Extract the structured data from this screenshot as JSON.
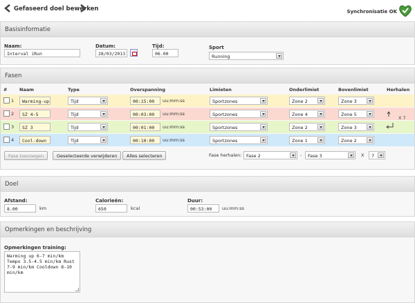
{
  "header": {
    "title": "Gefaseerd doel bewerken",
    "sync_status": "Synchronisatie OK"
  },
  "basis": {
    "heading": "Basisinformatie",
    "name_label": "Naam:",
    "name_value": "Interval iRun",
    "date_label": "Datum:",
    "date_value": "28/03/2013",
    "time_label": "Tijd:",
    "time_value": "06.00",
    "sport_label": "Sport",
    "sport_value": "Running"
  },
  "fasen": {
    "heading": "Fasen",
    "columns": [
      "#",
      "Naam",
      "Type",
      "Overspanning",
      "Limieten",
      "Onderlimiet",
      "Bovenlimiet",
      "Herhalen"
    ],
    "rows": [
      {
        "num": "1",
        "name": "Warming-up",
        "type": "Tijd",
        "span": "00:15:00",
        "unit": "uu:mm:ss",
        "limit": "Sportzones",
        "lower": "Zone 2",
        "upper": "Zone 3",
        "color": "#fdf3c6"
      },
      {
        "num": "2",
        "name": "SZ 4-5",
        "type": "Tijd",
        "span": "00:03:00",
        "unit": "uu:mm:ss",
        "limit": "Sportzones",
        "lower": "Zone 4",
        "upper": "Zone 5",
        "color": "#fbd9d1"
      },
      {
        "num": "3",
        "name": "SZ 3",
        "type": "Tijd",
        "span": "00:01:00",
        "unit": "uu:mm:ss",
        "limit": "Sportzones",
        "lower": "Zone 2",
        "upper": "Zone 3",
        "color": "#e7f6c8"
      },
      {
        "num": "4",
        "name": "Cool-down",
        "type": "Tijd",
        "span": "00:10:00",
        "unit": "uu:mm:ss",
        "limit": "Sportzones",
        "lower": "Zone 1",
        "upper": "Zone 2",
        "color": "#cfe9fb"
      }
    ],
    "repeat_label": "X 7",
    "btn_add": "Fase toevoegen",
    "btn_delete": "Geselecteerde verwijderen",
    "btn_select_all": "Alles selecteren",
    "repeat_phase_label": "Fase herhalen:",
    "repeat_from": "Fase 2",
    "repeat_dash": "-",
    "repeat_to": "Fase 3",
    "repeat_x": "X",
    "repeat_count": "7"
  },
  "doel": {
    "heading": "Doel",
    "distance_label": "Afstand:",
    "distance_value": "8.00",
    "distance_unit": "km",
    "calories_label": "Calorieën:",
    "calories_value": "650",
    "calories_unit": "kcal",
    "duration_label": "Duur:",
    "duration_value": "00:53:00",
    "duration_unit": "uu:mm:ss"
  },
  "notes": {
    "heading": "Opmerkingen en beschrijving",
    "training_label": "Opmerkingen training:",
    "training_value": "Warming up 6-7 min/km Tempo 3.5-4.5 min/km Rust 7-9 min/km Cooldown 8-10 min/km"
  },
  "colors": {
    "row1": "#fdf3c6",
    "row2": "#fbd9d1",
    "row3": "#e7f6c8",
    "row4": "#cfe9fb",
    "sync_icon": "#4a9a3a"
  },
  "icons": {
    "prev": "chevron-left-icon",
    "next": "chevron-right-icon",
    "sync": "heart-check-icon",
    "calendar": "calendar-icon",
    "repeat": "repeat-arrow-icon"
  }
}
